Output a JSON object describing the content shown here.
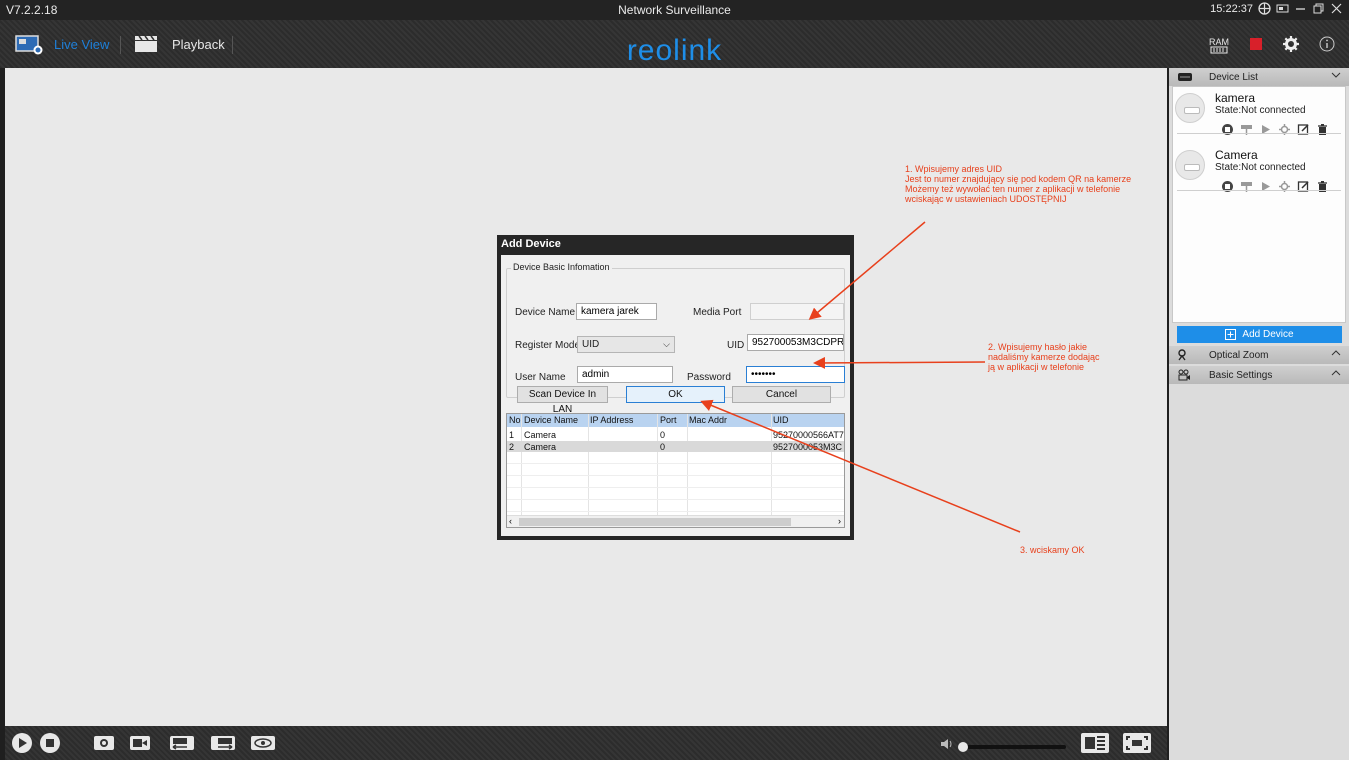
{
  "window": {
    "version": "V7.2.2.18",
    "title": "Network Surveillance",
    "clock": "15:22:37"
  },
  "nav": {
    "live_view": "Live View",
    "playback": "Playback",
    "logo": "reolink",
    "ram": "RAM"
  },
  "dialog": {
    "title": "Add Device",
    "group_title": "Device Basic Infomation",
    "device_name_label": "Device Name",
    "device_name_value": "kamera jarek",
    "media_port_label": "Media Port",
    "media_port_value": "",
    "register_mode_label": "Register Mode",
    "register_mode_value": "UID",
    "uid_label": "UID",
    "uid_value": "952700053M3CDPR",
    "user_name_label": "User Name",
    "user_name_value": "admin",
    "password_label": "Password",
    "password_value": "•••••••",
    "scan_button": "Scan Device In LAN",
    "ok_button": "OK",
    "cancel_button": "Cancel",
    "table": {
      "columns": [
        "No.",
        "Device Name",
        "IP Address",
        "Port",
        "Mac Addr",
        "UID"
      ],
      "rows": [
        [
          "1",
          "Camera",
          "",
          "0",
          "",
          "95270000566AT7"
        ],
        [
          "2",
          "Camera",
          "",
          "0",
          "",
          "9527000053M3C"
        ]
      ]
    }
  },
  "panel": {
    "device_list_title": "Device List",
    "devices": [
      {
        "name": "kamera",
        "state": "State:Not connected"
      },
      {
        "name": "Camera",
        "state": "State:Not connected"
      }
    ],
    "add_device": "Add Device",
    "optical_zoom": "Optical Zoom",
    "basic_settings": "Basic Settings"
  },
  "annotations": {
    "note1": [
      "1. Wpisujemy adres UID",
      "Jest to numer znajdujący się pod kodem QR na kamerze",
      "Możemy też wywołać ten numer z aplikacji w telefonie",
      "wciskając w ustawieniach UDOSTĘPNIJ"
    ],
    "note2": [
      "2. Wpisujemy hasło jakie",
      "nadaliśmy kamerze dodając",
      "ją w aplikacji w telefonie"
    ],
    "note3": "3. wciskamy OK",
    "color": "#e8401c"
  },
  "colors": {
    "accent": "#1e8ee8",
    "main_bg": "#e9e9e9",
    "dialog_frame": "#262626"
  }
}
